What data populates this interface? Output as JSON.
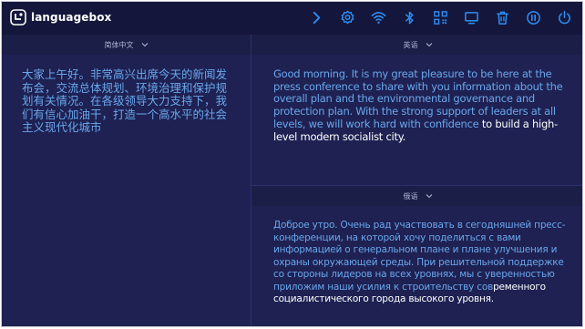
{
  "app": {
    "brand": "languagebox"
  },
  "toolbar": {
    "icons": [
      "chevron-right-icon",
      "settings-icon",
      "wifi-icon",
      "bluetooth-icon",
      "qr-code-icon",
      "monitor-icon",
      "trash-icon",
      "pause-icon",
      "power-icon"
    ]
  },
  "source": {
    "language": "简体中文",
    "text": "大家上午好。非常高兴出席今天的新闻发布会，交流总体规划、环境治理和保护规划有关情况。在各级领导大力支持下，我们有信心加油干，打造一个高水平的社会主义现代化城市"
  },
  "target_en": {
    "language": "英语",
    "text_highlighted": "Good morning. It is my great pleasure to be here at the press conference to share with you information about the overall plan and the environmental governance and protection plan. With the strong support of leaders at all levels, we will work hard with confidence",
    "text_plain": " to build a high-level modern socialist city."
  },
  "target_ru": {
    "language": "俄语",
    "text_highlighted": "Доброе утро. Очень рад участвовать в сегодняшней пресс-конференции, на которой хочу поделиться с вами информацией о генеральном плане и плане улучшения и охраны окружающей среды. При решительной поддержке со стороны лидеров на всех уровнях, мы с уверенностью приложим наши усилия к строительству сов",
    "text_plain": "ременного социалистического города высокого уровня."
  },
  "colors": {
    "highlight": "#6aa7ec",
    "background": "#1b1e48",
    "topbar": "#14173b"
  }
}
